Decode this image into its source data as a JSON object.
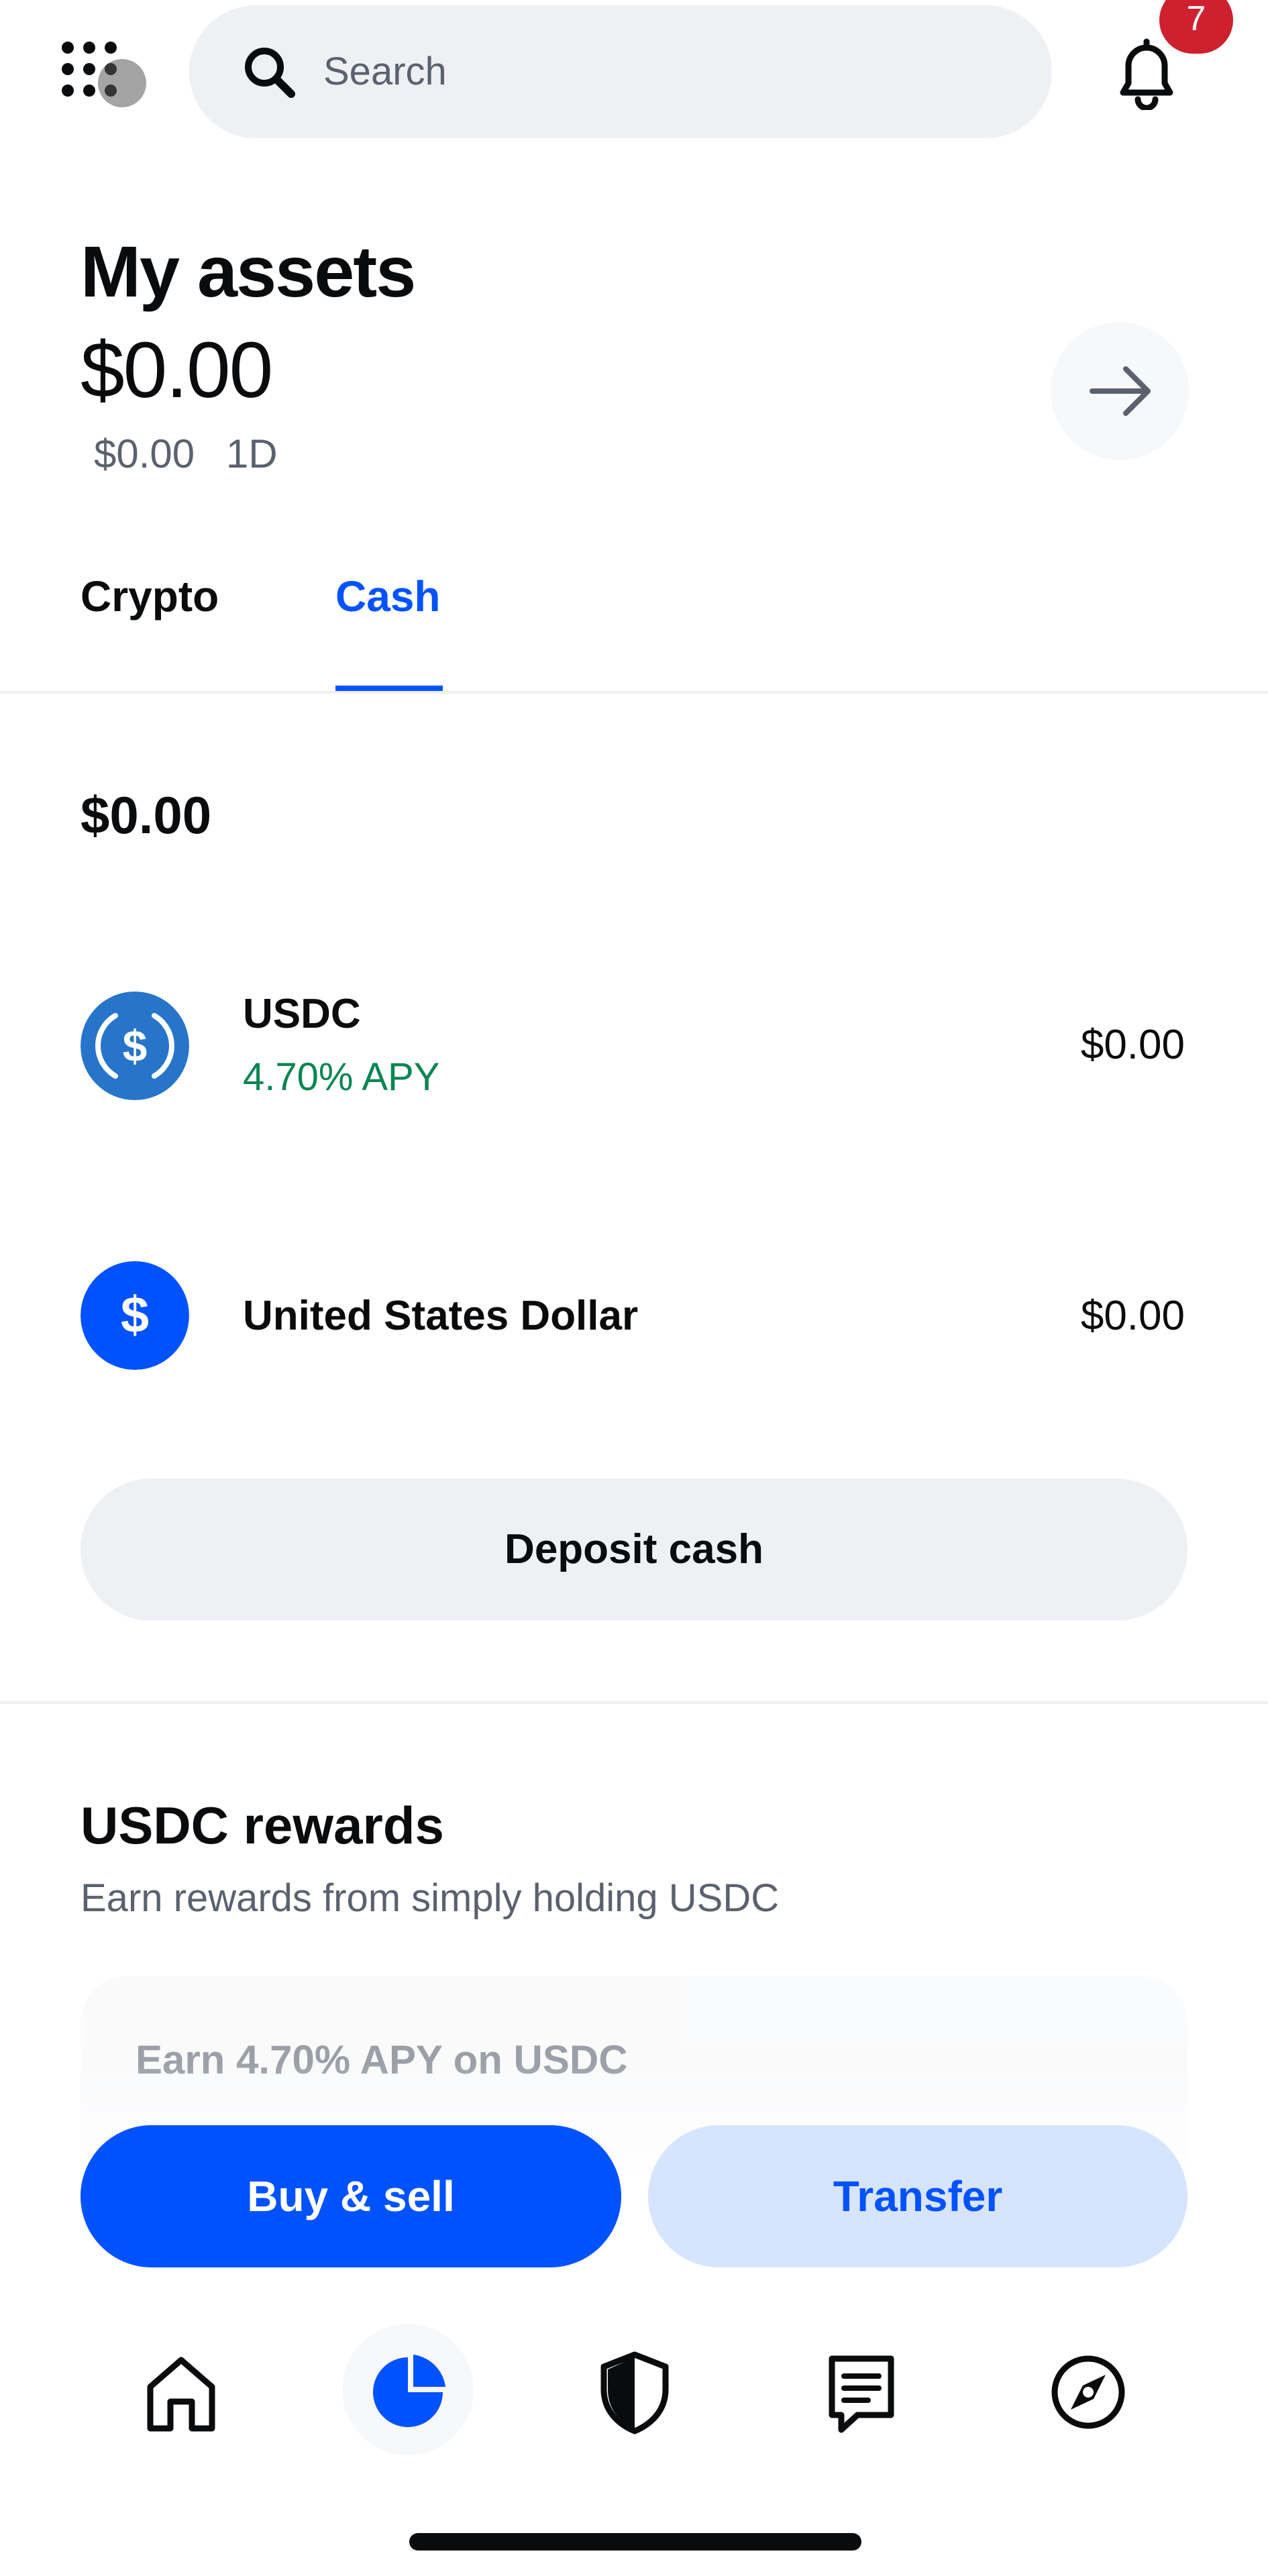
{
  "top_bar": {
    "search_placeholder": "Search",
    "notification_count": "7",
    "icons": [
      "apps-grid-icon",
      "search-icon",
      "bell-icon"
    ]
  },
  "header": {
    "title": "My assets",
    "total_balance": "$0.00",
    "change_value": "$0.00",
    "change_period": "1D"
  },
  "tabs": [
    {
      "label": "Crypto",
      "active": false
    },
    {
      "label": "Cash",
      "active": true
    }
  ],
  "cash": {
    "total": "$0.00",
    "assets": [
      {
        "name": "USDC",
        "apy": "4.70% APY",
        "value": "$0.00",
        "icon": "usdc-icon"
      },
      {
        "name": "United States Dollar",
        "value": "$0.00",
        "icon": "dollar-icon"
      }
    ],
    "deposit_label": "Deposit cash"
  },
  "rewards": {
    "title": "USDC rewards",
    "subtitle": "Earn rewards from simply holding USDC",
    "card_title": "Earn 4.70% APY on USDC"
  },
  "actions": {
    "buy_sell_label": "Buy & sell",
    "transfer_label": "Transfer"
  },
  "bottom_nav": {
    "items": [
      "home-icon",
      "assets-icon",
      "shield-icon",
      "transactions-icon",
      "explore-icon"
    ],
    "active": "assets-icon"
  },
  "colors": {
    "accent": "#0052ff",
    "positive": "#098551",
    "badge": "#cf202f",
    "surface": "#eef0f3"
  }
}
